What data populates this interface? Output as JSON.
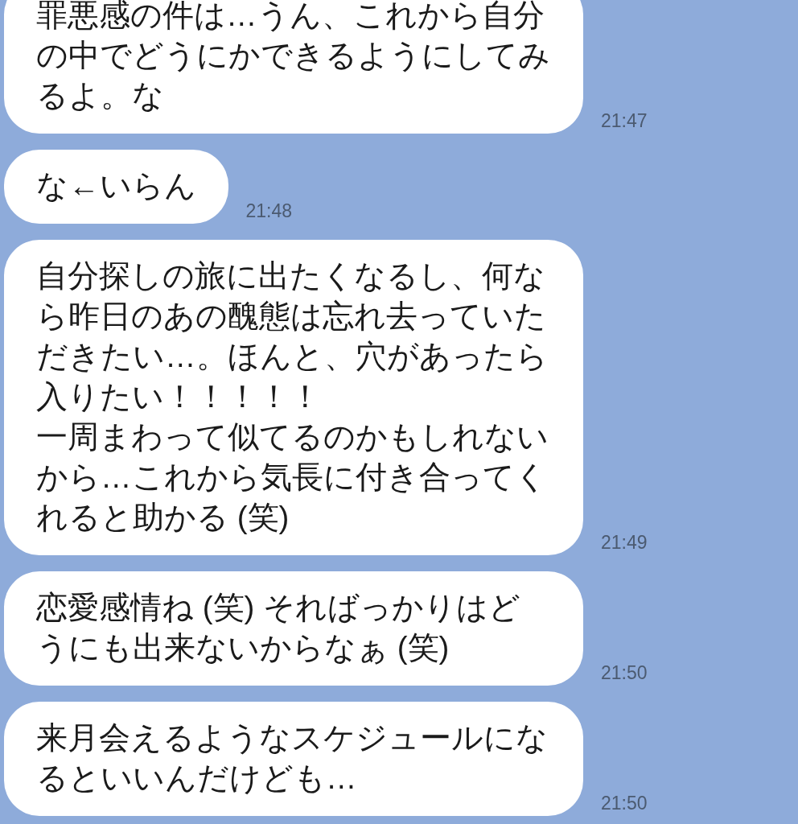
{
  "messages": [
    {
      "paragraphs": [
        "罪悪感の件は…うん、これから自分の中でどうにかできるようにしてみるよ。な"
      ],
      "time": "21:47"
    },
    {
      "paragraphs": [
        "な←いらん"
      ],
      "time": "21:48"
    },
    {
      "paragraphs": [
        "自分探しの旅に出たくなるし、何なら昨日のあの醜態は忘れ去っていただきたい…。ほんと、穴があったら入りたい！！！！！",
        "一周まわって似てるのかもしれないから…これから気長に付き合ってくれると助かる (笑)"
      ],
      "time": "21:49"
    },
    {
      "paragraphs": [
        "恋愛感情ね (笑) そればっかりはどうにも出来ないからなぁ (笑)"
      ],
      "time": "21:50"
    },
    {
      "paragraphs": [
        "来月会えるようなスケジュールになるといいんだけども…"
      ],
      "time": "21:50"
    }
  ]
}
